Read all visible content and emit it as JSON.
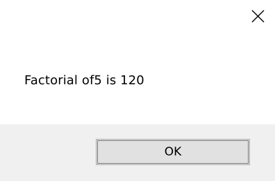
{
  "dialog": {
    "message": "Factorial of5 is 120",
    "close_icon": "close-icon",
    "ok_label": "OK"
  }
}
